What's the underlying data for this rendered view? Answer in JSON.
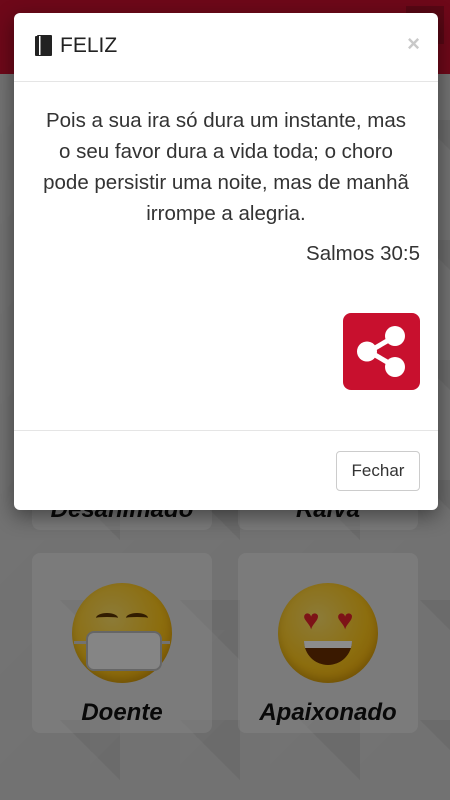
{
  "background": {
    "mood_cards": [
      {
        "label": "Desanimado"
      },
      {
        "label": "Raiva"
      },
      {
        "label": "Doente",
        "emoji": "mask-face-icon"
      },
      {
        "label": "Apaixonado",
        "emoji": "heart-eyes-icon"
      }
    ]
  },
  "modal": {
    "title": "FELIZ",
    "title_icon": "book-icon",
    "close_symbol": "×",
    "verse": "Pois a sua ira só dura um instante, mas o seu favor dura a vida toda; o choro pode persistir uma noite, mas de manhã irrompe a alegria.",
    "reference": "Salmos 30:5",
    "share_icon": "share-icon",
    "footer_button": "Fechar"
  },
  "colors": {
    "accent": "#c8102e"
  }
}
